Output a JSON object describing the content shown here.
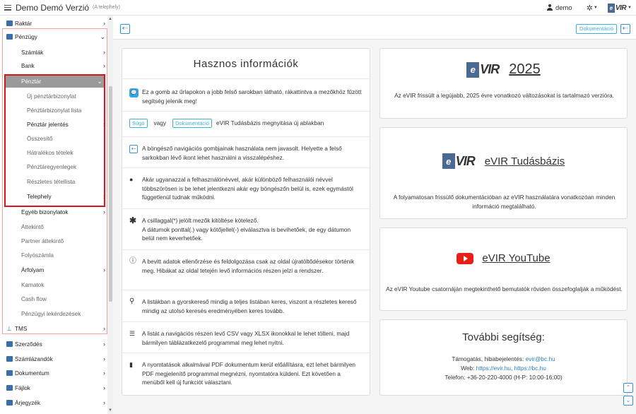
{
  "header": {
    "title": "Demo Demó Verzió",
    "subtitle": "(A telephely)",
    "user": "demo",
    "logo_e": "e",
    "logo_vir": "VIR"
  },
  "sidebar": {
    "items": [
      {
        "label": "Raktár",
        "level": 0,
        "icon": "warehouse-icon",
        "chevron": "›"
      },
      {
        "label": "Pénzügy",
        "level": 0,
        "icon": "money-icon",
        "chevron": "⌄"
      },
      {
        "label": "Számlák",
        "level": 1,
        "chevron": "›"
      },
      {
        "label": "Bank",
        "level": 1,
        "chevron": "›"
      },
      {
        "label": "Pénztár",
        "level": 1,
        "chevron": "⌄",
        "active": true
      },
      {
        "label": "Új pénztárbizonylat",
        "level": 2
      },
      {
        "label": "Pénztárbizonylat lista",
        "level": 2
      },
      {
        "label": "Pénztár jelentés",
        "level": 2,
        "chevron": "›"
      },
      {
        "label": "Összesítő",
        "level": 2
      },
      {
        "label": "Hátralékos tételek",
        "level": 2
      },
      {
        "label": "Pénztáregyenlegek",
        "level": 2
      },
      {
        "label": "Részletes tétellista",
        "level": 2
      },
      {
        "label": "Telephely",
        "level": 2,
        "chevron": "›"
      },
      {
        "label": "Egyéb bizonylatok",
        "level": 1,
        "chevron": "›"
      },
      {
        "label": "Áttekintő",
        "level": 1
      },
      {
        "label": "Partner áttekintő",
        "level": 1
      },
      {
        "label": "Folyószámla",
        "level": 1
      },
      {
        "label": "Árfolyam",
        "level": 1,
        "chevron": "›"
      },
      {
        "label": "Kamatok",
        "level": 1
      },
      {
        "label": "Cash flow",
        "level": 1
      },
      {
        "label": "Pénzügyi lekérdezések",
        "level": 1
      },
      {
        "label": "TMS",
        "level": 0,
        "icon": "pin-icon",
        "chevron": "›"
      },
      {
        "label": "Szerződés",
        "level": 0,
        "icon": "contract-icon",
        "chevron": "›"
      },
      {
        "label": "Számlázandók",
        "level": 0,
        "icon": "invoice-icon",
        "chevron": "›"
      },
      {
        "label": "Dokumentum",
        "level": 0,
        "icon": "document-icon",
        "chevron": "›"
      },
      {
        "label": "Fájlok",
        "level": 0,
        "icon": "file-icon",
        "chevron": "›"
      },
      {
        "label": "Árjegyzék",
        "level": 0,
        "icon": "tag-icon",
        "chevron": "›"
      }
    ]
  },
  "toolbar": {
    "doc_label": "Dokumentáció"
  },
  "info": {
    "title": "Hasznos információk",
    "items": [
      {
        "icon": "chat-icon",
        "text": "Ez a gomb az űrlapokon a jobb felső sarokban látható, rákattintva a mezőkhöz fűzött segítség jelenik meg!"
      },
      {
        "icon": "help-buttons",
        "sugo": "Súgó",
        "vagy": "vagy",
        "doc": "Dokumentáció",
        "text": "eVIR Tudásbázis megnyitása új ablakban"
      },
      {
        "icon": "back-icon",
        "text": "A böngésző navigációs gombjainak használata nem javasolt. Helyette a felső sarkokban lévő ikont lehet használni a visszalépéshez."
      },
      {
        "icon": "user-icon",
        "text": "Akár ugyanazzal a felhasználónévvel, akár különböző felhasználói névvel többszörösen is be lehet jelentkezni akár egy böngészőn belül is, ezek egymástól függetlenül tudnak működni."
      },
      {
        "icon": "asterisk-icon",
        "text": "A csillaggal(*) jelölt mezők kitöltése kötelező."
      },
      {
        "icon": "asterisk-icon-cont",
        "text": "A dátumok ponttal(.) vagy kötőjellel(-) elválasztva is bevihetőek, de egy dátumon belül nem keverhetőek."
      },
      {
        "icon": "info-icon",
        "text": "A bevitt adatok ellenőrzése és feldolgozása csak az oldal újratöltődésekor történik meg. Hibákat az oldal tetején levő információs részen jelzi a rendszer."
      },
      {
        "icon": "search-icon",
        "text": "A listákban a gyorskereső mindig a teljes listában keres, viszont a részletes kereső mindig az utolsó keresés eredményében keres tovább."
      },
      {
        "icon": "list-icon",
        "text": "A listát a navigációs részen levő CSV vagy XLSX ikonokkal le lehet tölteni, majd bármilyen táblázatkezelő programmal meg lehet nyitni."
      },
      {
        "icon": "pdf-icon",
        "text": "A nyomtatások alkalmával PDF dokumentum kerül előállításra, ezt lehet bármilyen PDF megjelenítő programmal megnézni, nyomtatóra küldeni. Ezt követően a menüből kell új funkciót választani."
      }
    ]
  },
  "cards": {
    "news": {
      "title": "2025",
      "desc": "Az eVIR frissült a legújabb, 2025 évre vonatkozó változásokat is tartalmazó verzióra."
    },
    "kb": {
      "title": "eVIR Tudásbázis",
      "desc": "A folyamatosan frissülő dokumentációban az eVIR használatára vonatkozóan minden információ megtalálható."
    },
    "yt": {
      "title": "eVIR YouTube",
      "desc": "Az eVIR Youtube csatornáján megtekinthető bemutatók röviden összefoglalják a működést."
    },
    "help": {
      "title": "További segítség:",
      "support_label": "Támogatás, hibabejelentés:",
      "support_email": "evir@bc.hu",
      "web_label": "Web:",
      "web_links": "https://evir.hu, https://bc.hu",
      "phone": "Telefon: +36-20-220-4000 (H-P: 10:00-16:00)"
    }
  },
  "colors": {
    "accent": "#3b8fd6",
    "active_bg": "#9a9a9a",
    "highlight": "#d8151b",
    "youtube": "#e62117"
  }
}
